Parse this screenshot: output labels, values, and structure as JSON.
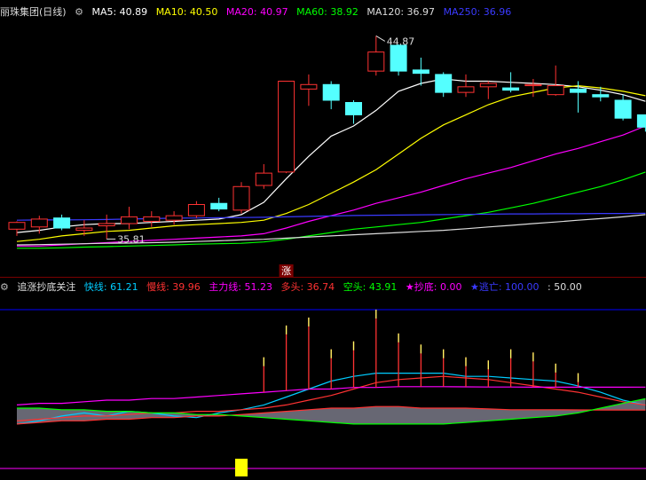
{
  "main_header": {
    "stock_name": "丽珠集团(日线)",
    "ma5": "MA5: 40.89",
    "ma10": "MA10: 40.50",
    "ma20": "MA20: 40.97",
    "ma60": "MA60: 38.92",
    "ma120": "MA120: 36.97",
    "ma250": "MA250: 36.96"
  },
  "sub_header": {
    "indicator_name": "追涨抄底关注",
    "fast": "快线: 61.21",
    "slow": "慢线: 39.96",
    "main_force": "主力线: 51.23",
    "long": "多头: 36.74",
    "short": "空头: 43.91",
    "bottom": "★抄底: 0.00",
    "escape": "★逃亡: 100.00",
    "value": ": 50.00"
  },
  "colors": {
    "up": "#ff3232",
    "down": "#54ffff",
    "ma5": "#ffffff",
    "ma10": "#ffff00",
    "ma20": "#ff00ff",
    "ma60": "#00ff00",
    "ma120": "#dddddd",
    "ma250": "#3a3aff",
    "fast": "#00ccff",
    "slow": "#ff3232",
    "main_force": "#ff00ff",
    "long": "#ff3232",
    "short": "#00ff00",
    "bottom": "#ff00ff",
    "escape": "#0000ff"
  },
  "chart_data": [
    {
      "type": "candlestick",
      "title": "丽珠集团(日线)",
      "ylim": [
        34.6,
        45.6
      ],
      "annotations": [
        {
          "label": "44.87",
          "index": 16,
          "value": 44.87
        },
        {
          "label": "35.81",
          "index": 4,
          "value": 35.81
        },
        {
          "label": "涨",
          "index": 12
        }
      ],
      "candles": [
        {
          "o": 36.25,
          "h": 36.6,
          "l": 35.95,
          "c": 36.55
        },
        {
          "o": 36.35,
          "h": 36.85,
          "l": 36.05,
          "c": 36.7
        },
        {
          "o": 36.75,
          "h": 36.9,
          "l": 36.2,
          "c": 36.3
        },
        {
          "o": 36.2,
          "h": 36.65,
          "l": 35.95,
          "c": 36.3
        },
        {
          "o": 36.4,
          "h": 36.9,
          "l": 35.81,
          "c": 36.5
        },
        {
          "o": 36.5,
          "h": 37.25,
          "l": 36.25,
          "c": 36.8
        },
        {
          "o": 36.6,
          "h": 37.05,
          "l": 36.35,
          "c": 36.8
        },
        {
          "o": 36.65,
          "h": 37.05,
          "l": 36.45,
          "c": 36.85
        },
        {
          "o": 36.85,
          "h": 37.5,
          "l": 36.75,
          "c": 37.35
        },
        {
          "o": 37.4,
          "h": 37.65,
          "l": 37.05,
          "c": 37.15
        },
        {
          "o": 37.1,
          "h": 38.35,
          "l": 36.95,
          "c": 38.15
        },
        {
          "o": 38.2,
          "h": 39.15,
          "l": 38.05,
          "c": 38.75
        },
        {
          "o": 38.8,
          "h": 42.8,
          "l": 38.75,
          "c": 42.85
        },
        {
          "o": 42.5,
          "h": 43.15,
          "l": 41.75,
          "c": 42.7
        },
        {
          "o": 42.7,
          "h": 42.85,
          "l": 41.6,
          "c": 42.0
        },
        {
          "o": 41.9,
          "h": 42.0,
          "l": 40.95,
          "c": 41.35
        },
        {
          "o": 43.3,
          "h": 44.87,
          "l": 43.1,
          "c": 44.15
        },
        {
          "o": 44.45,
          "h": 44.5,
          "l": 43.1,
          "c": 43.3
        },
        {
          "o": 43.35,
          "h": 43.9,
          "l": 42.65,
          "c": 43.2
        },
        {
          "o": 43.15,
          "h": 43.25,
          "l": 42.15,
          "c": 42.35
        },
        {
          "o": 42.35,
          "h": 43.15,
          "l": 42.15,
          "c": 42.6
        },
        {
          "o": 42.6,
          "h": 42.85,
          "l": 42.05,
          "c": 42.75
        },
        {
          "o": 42.55,
          "h": 43.25,
          "l": 42.35,
          "c": 42.45
        },
        {
          "o": 42.65,
          "h": 42.95,
          "l": 42.15,
          "c": 42.7
        },
        {
          "o": 42.25,
          "h": 43.55,
          "l": 42.2,
          "c": 42.65
        },
        {
          "o": 42.5,
          "h": 42.85,
          "l": 41.45,
          "c": 42.35
        },
        {
          "o": 42.25,
          "h": 42.6,
          "l": 41.95,
          "c": 42.15
        },
        {
          "o": 42.0,
          "h": 42.25,
          "l": 41.1,
          "c": 41.2
        },
        {
          "o": 41.35,
          "h": 41.35,
          "l": 40.6,
          "c": 40.8
        }
      ],
      "series": [
        {
          "name": "MA5",
          "values": [
            36.1,
            36.2,
            36.35,
            36.45,
            36.5,
            36.5,
            36.55,
            36.6,
            36.65,
            36.7,
            36.9,
            37.45,
            38.5,
            39.5,
            40.4,
            40.85,
            41.55,
            42.4,
            42.75,
            42.95,
            42.85,
            42.85,
            42.8,
            42.75,
            42.7,
            42.6,
            42.45,
            42.25,
            41.95
          ]
        },
        {
          "name": "MA10",
          "values": [
            35.7,
            35.8,
            35.95,
            36.05,
            36.15,
            36.2,
            36.3,
            36.4,
            36.45,
            36.5,
            36.55,
            36.65,
            36.95,
            37.35,
            37.85,
            38.35,
            38.9,
            39.6,
            40.3,
            40.9,
            41.35,
            41.8,
            42.15,
            42.35,
            42.55,
            42.65,
            42.55,
            42.4,
            42.2
          ]
        },
        {
          "name": "MA20",
          "values": [
            35.5,
            35.5,
            35.55,
            35.6,
            35.65,
            35.7,
            35.75,
            35.8,
            35.85,
            35.9,
            35.95,
            36.05,
            36.3,
            36.6,
            36.85,
            37.1,
            37.4,
            37.65,
            37.9,
            38.2,
            38.5,
            38.75,
            39.0,
            39.3,
            39.6,
            39.85,
            40.15,
            40.45,
            40.85
          ]
        },
        {
          "name": "MA60",
          "values": [
            35.4,
            35.4,
            35.42,
            35.45,
            35.47,
            35.5,
            35.52,
            35.55,
            35.58,
            35.6,
            35.62,
            35.68,
            35.8,
            35.95,
            36.1,
            36.25,
            36.35,
            36.45,
            36.55,
            36.7,
            36.85,
            37.0,
            37.2,
            37.4,
            37.65,
            37.9,
            38.15,
            38.45,
            38.8
          ]
        },
        {
          "name": "MA120",
          "values": [
            35.55,
            35.56,
            35.58,
            35.6,
            35.62,
            35.63,
            35.65,
            35.67,
            35.7,
            35.73,
            35.77,
            35.8,
            35.85,
            35.9,
            35.95,
            36.0,
            36.05,
            36.1,
            36.15,
            36.2,
            36.27,
            36.35,
            36.42,
            36.5,
            36.57,
            36.65,
            36.72,
            36.8,
            36.9
          ]
        },
        {
          "name": "MA250",
          "values": [
            36.65,
            36.66,
            36.66,
            36.67,
            36.68,
            36.7,
            36.72,
            36.74,
            36.75,
            36.76,
            36.77,
            36.78,
            36.8,
            36.82,
            36.84,
            36.86,
            36.87,
            36.88,
            36.89,
            36.9,
            36.91,
            36.92,
            36.93,
            36.93,
            36.94,
            36.94,
            36.95,
            36.95,
            36.96
          ]
        }
      ]
    },
    {
      "type": "line",
      "title": "追涨抄底关注",
      "ylim": [
        -5,
        105
      ],
      "levels": [
        {
          "name": "★逃亡",
          "value": 100
        },
        {
          "name": "★抄底",
          "value": 0
        }
      ],
      "series": [
        {
          "name": "快线",
          "values": [
            28,
            30,
            33,
            35,
            33,
            36,
            35,
            33,
            32,
            35,
            37,
            40,
            45,
            50,
            55,
            58,
            60,
            60,
            60,
            60,
            58,
            58,
            57,
            56,
            55,
            52,
            48,
            43,
            40
          ]
        },
        {
          "name": "慢线",
          "values": [
            30,
            31,
            32,
            33,
            33,
            34,
            35,
            35,
            36,
            36,
            37,
            38,
            40,
            43,
            46,
            50,
            54,
            56,
            57,
            58,
            57,
            56,
            54,
            52,
            50,
            48,
            45,
            42,
            39.96
          ]
        },
        {
          "name": "主力线",
          "values": [
            40,
            41,
            41,
            42,
            43,
            43,
            44,
            44,
            45,
            46,
            47,
            48,
            49,
            50,
            50,
            51,
            51,
            51.5,
            51.5,
            51.5,
            51.4,
            51.3,
            51.3,
            51.2,
            51.2,
            51.2,
            51.2,
            51.2,
            51.23
          ]
        },
        {
          "name": "多头",
          "values": [
            28,
            29,
            30,
            30,
            31,
            31,
            32,
            32,
            33,
            33,
            34,
            35,
            36,
            37,
            38,
            38,
            39,
            39,
            38,
            38,
            38,
            37.5,
            37,
            37,
            37,
            36.9,
            36.8,
            36.8,
            36.74
          ]
        },
        {
          "name": "空头",
          "values": [
            38,
            38,
            37,
            37,
            36,
            36,
            35,
            35,
            34,
            34,
            33,
            32,
            31,
            30,
            29,
            28,
            28,
            28,
            28,
            28,
            29,
            30,
            31,
            32,
            33,
            35,
            38,
            41,
            43.91
          ]
        }
      ],
      "spikes": [
        {
          "index": 11,
          "value": 70
        },
        {
          "index": 12,
          "value": 90
        },
        {
          "index": 13,
          "value": 95
        },
        {
          "index": 14,
          "value": 75
        },
        {
          "index": 15,
          "value": 80
        },
        {
          "index": 16,
          "value": 100
        },
        {
          "index": 17,
          "value": 85
        },
        {
          "index": 18,
          "value": 78
        },
        {
          "index": 19,
          "value": 75
        },
        {
          "index": 20,
          "value": 70
        },
        {
          "index": 21,
          "value": 68
        },
        {
          "index": 22,
          "value": 75
        },
        {
          "index": 23,
          "value": 73
        },
        {
          "index": 24,
          "value": 66
        },
        {
          "index": 25,
          "value": 60
        }
      ],
      "markers": [
        {
          "index": 10,
          "value": 50
        }
      ]
    }
  ]
}
